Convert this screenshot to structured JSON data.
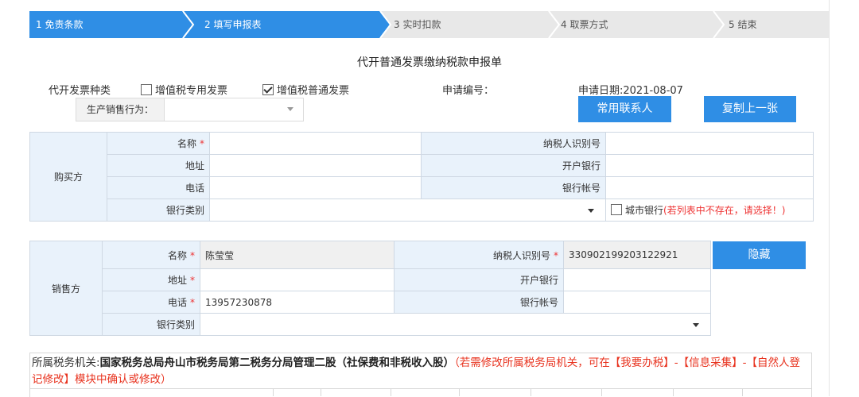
{
  "steps": [
    {
      "label": "1 免责条款",
      "state": "done"
    },
    {
      "label": "2 填写申报表",
      "state": "active"
    },
    {
      "label": "3 实时扣款",
      "state": "pending"
    },
    {
      "label": "4 取票方式",
      "state": "pending"
    },
    {
      "label": "5 结束",
      "state": "pending"
    }
  ],
  "colors": {
    "accent": "#2f8ee5",
    "inactive_step": "#e8e8e8",
    "required": "#e33333",
    "label_bg": "#e9f2fb"
  },
  "form_title": "代开普通发票缴纳税款申报单",
  "invoice_type": {
    "label": "代开发票种类",
    "options": [
      {
        "label": "增值税专用发票",
        "checked": false
      },
      {
        "label": "增值税普通发票",
        "checked": true
      }
    ]
  },
  "application_no": {
    "label": "申请编号：",
    "value": ""
  },
  "application_date": "申请日期:2021-08-07",
  "behavior": {
    "label": "生产销售行为：",
    "value": ""
  },
  "buttons": {
    "common_contacts": "常用联系人",
    "copy_previous": "复制上一张",
    "hide": "隐藏"
  },
  "buyer": {
    "section": "购买方",
    "name_label": "名称",
    "taxid_label": "纳税人识别号",
    "address_label": "地址",
    "bank_label": "开户银行",
    "phone_label": "电话",
    "account_label": "银行帐号",
    "bank_type_label": "银行类别",
    "city_bank_label": "城市银行",
    "city_bank_hint": "(若列表中不存在，请选择！)",
    "name": "",
    "taxid": "",
    "address": "",
    "bank": "",
    "phone": "",
    "account": ""
  },
  "seller": {
    "section": "销售方",
    "name_label": "名称",
    "taxid_label": "纳税人识别号",
    "address_label": "地址",
    "bank_label": "开户银行",
    "phone_label": "电话",
    "account_label": "银行帐号",
    "bank_type_label": "银行类别",
    "name": "陈莹莹",
    "taxid": "330902199203122921",
    "address": "",
    "bank": "",
    "phone": "13957230878",
    "account": ""
  },
  "tax_authority": {
    "prefix": "所属税务机关:",
    "name": "国家税务总局舟山市税务局第二税务分局管理二股（社保费和非税收入股）",
    "note": "（若需修改所属税务局机关，可在【我要办税】-【信息采集】-【自然人登记修改】模块中确认或修改）"
  }
}
